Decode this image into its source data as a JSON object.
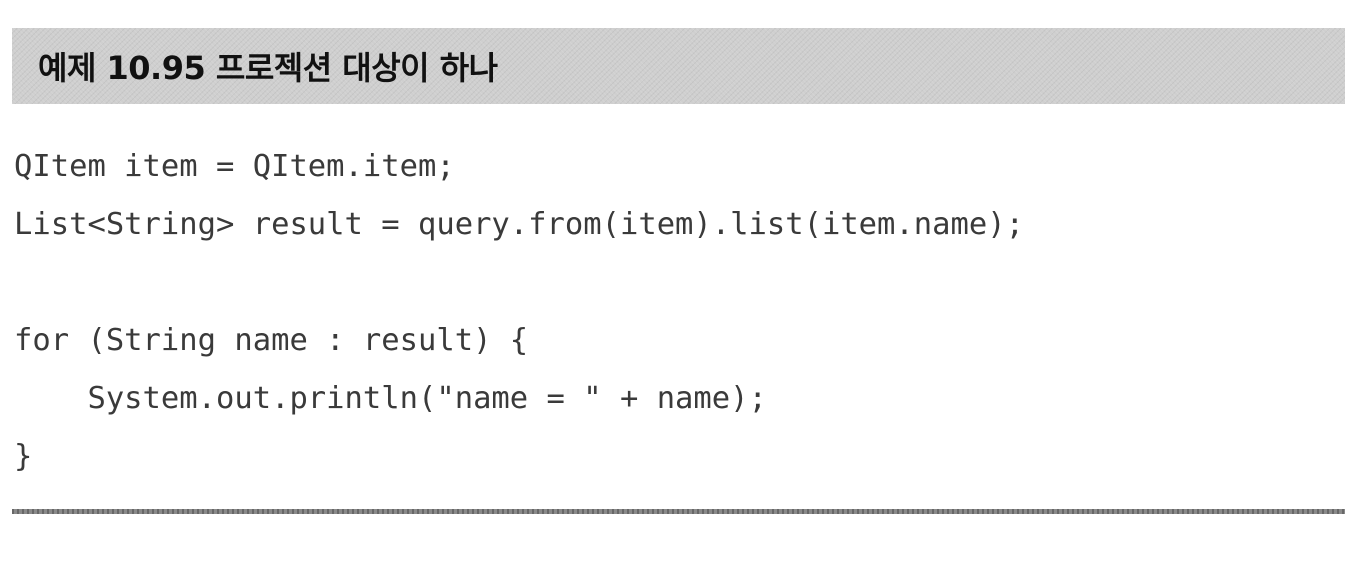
{
  "example": {
    "title": "예제 10.95 프로젝션 대상이 하나"
  },
  "code": {
    "lines": [
      "QItem item = QItem.item;",
      "List<String> result = query.from(item).list(item.name);",
      "",
      "for (String name : result) {",
      "    System.out.println(\"name = \" + name);",
      "}"
    ]
  }
}
